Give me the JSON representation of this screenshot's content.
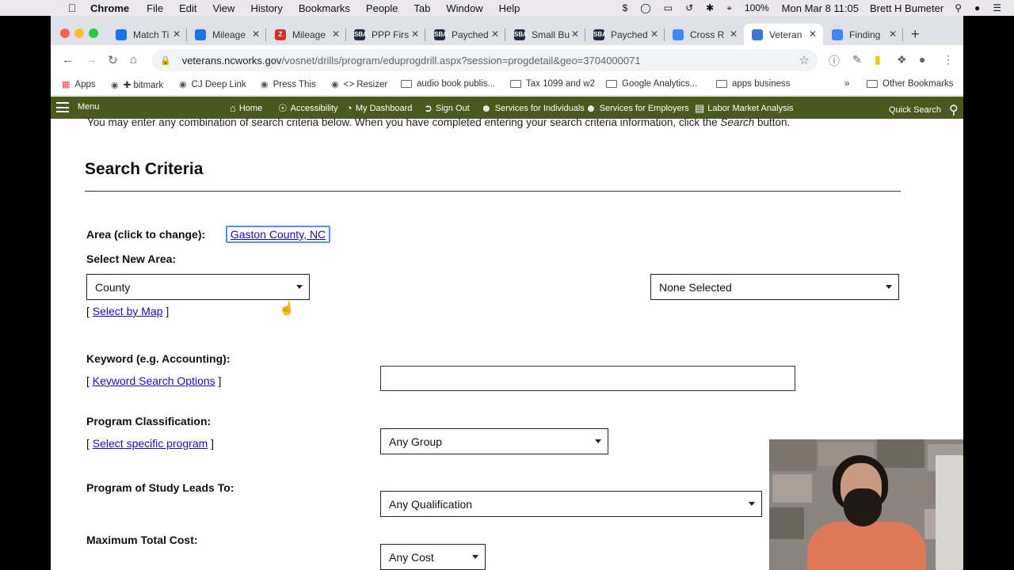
{
  "mac_menu": {
    "app": "Chrome",
    "items": [
      "File",
      "Edit",
      "View",
      "History",
      "Bookmarks",
      "People",
      "Tab",
      "Window",
      "Help"
    ],
    "battery": "100%",
    "clock": "Mon Mar 8  11:05",
    "user": "Brett H Bumeter"
  },
  "tabs": [
    {
      "label": "Match Ti",
      "color": "#1a73e8",
      "fav": ""
    },
    {
      "label": "Mileage",
      "color": "#1a73e8",
      "fav": ""
    },
    {
      "label": "Mileage",
      "color": "#d93025",
      "fav": "Z"
    },
    {
      "label": "PPP Firs",
      "color": "#1f2a44",
      "fav": "SBA"
    },
    {
      "label": "Payched",
      "color": "#1f2a44",
      "fav": "SBA"
    },
    {
      "label": "Small Bu",
      "color": "#1f2a44",
      "fav": "SBA"
    },
    {
      "label": "Payched",
      "color": "#1f2a44",
      "fav": "SBA"
    },
    {
      "label": "Cross R",
      "color": "#4285f4",
      "fav": ""
    },
    {
      "label": "Veteran",
      "color": "#3c78d8",
      "fav": ""
    },
    {
      "label": "Finding",
      "color": "#4285f4",
      "fav": ""
    }
  ],
  "address": {
    "host": "veterans.ncworks.gov",
    "path": "/vosnet/drills/program/eduprogdrill.aspx?session=progdetail&geo=3704000071"
  },
  "bookmarks": [
    {
      "label": "Apps",
      "icon": "apps-icon"
    },
    {
      "label": "✚ bitmark",
      "icon": "globe-icon"
    },
    {
      "label": "CJ Deep Link",
      "icon": "globe-icon"
    },
    {
      "label": "Press This",
      "icon": "globe-icon"
    },
    {
      "label": "<> Resizer",
      "icon": "globe-icon"
    },
    {
      "label": "audio book publis...",
      "icon": "folder-icon"
    },
    {
      "label": "Tax 1099 and w2",
      "icon": "folder-icon"
    },
    {
      "label": "Google Analytics...",
      "icon": "folder-icon"
    },
    {
      "label": "apps business",
      "icon": "folder-icon"
    },
    {
      "label": "»",
      "icon": ""
    },
    {
      "label": "Other Bookmarks",
      "icon": "folder-icon"
    }
  ],
  "sitenav": {
    "menu": "Menu",
    "items": [
      "Home",
      "Accessibility",
      "My Dashboard",
      "Sign Out",
      "Services for Individuals",
      "Services for Employers",
      "Labor Market Analysis"
    ],
    "quick_search": "Quick Search"
  },
  "content": {
    "intro_a": "You may enter any combination of search criteria below. When you have completed entering your search criteria information, click the ",
    "intro_em": "Search",
    "intro_b": " button.",
    "heading": "Search Criteria",
    "area_label": "Area (click to change):",
    "area_value": "Gaston County, NC",
    "select_new_area": "Select New Area:",
    "area_type": "County",
    "area_choice": "None Selected",
    "select_by_map": "Select by Map",
    "keyword_label": "Keyword (e.g. Accounting):",
    "keyword_value": "",
    "keyword_options": "Keyword Search Options",
    "program_class_label": "Program Classification:",
    "program_class_value": "Any Group",
    "select_specific": "Select specific program",
    "leads_to_label": "Program of Study Leads To:",
    "leads_to_value": "Any Qualification",
    "max_cost_label": "Maximum Total Cost:",
    "max_cost_value": "Any Cost"
  }
}
